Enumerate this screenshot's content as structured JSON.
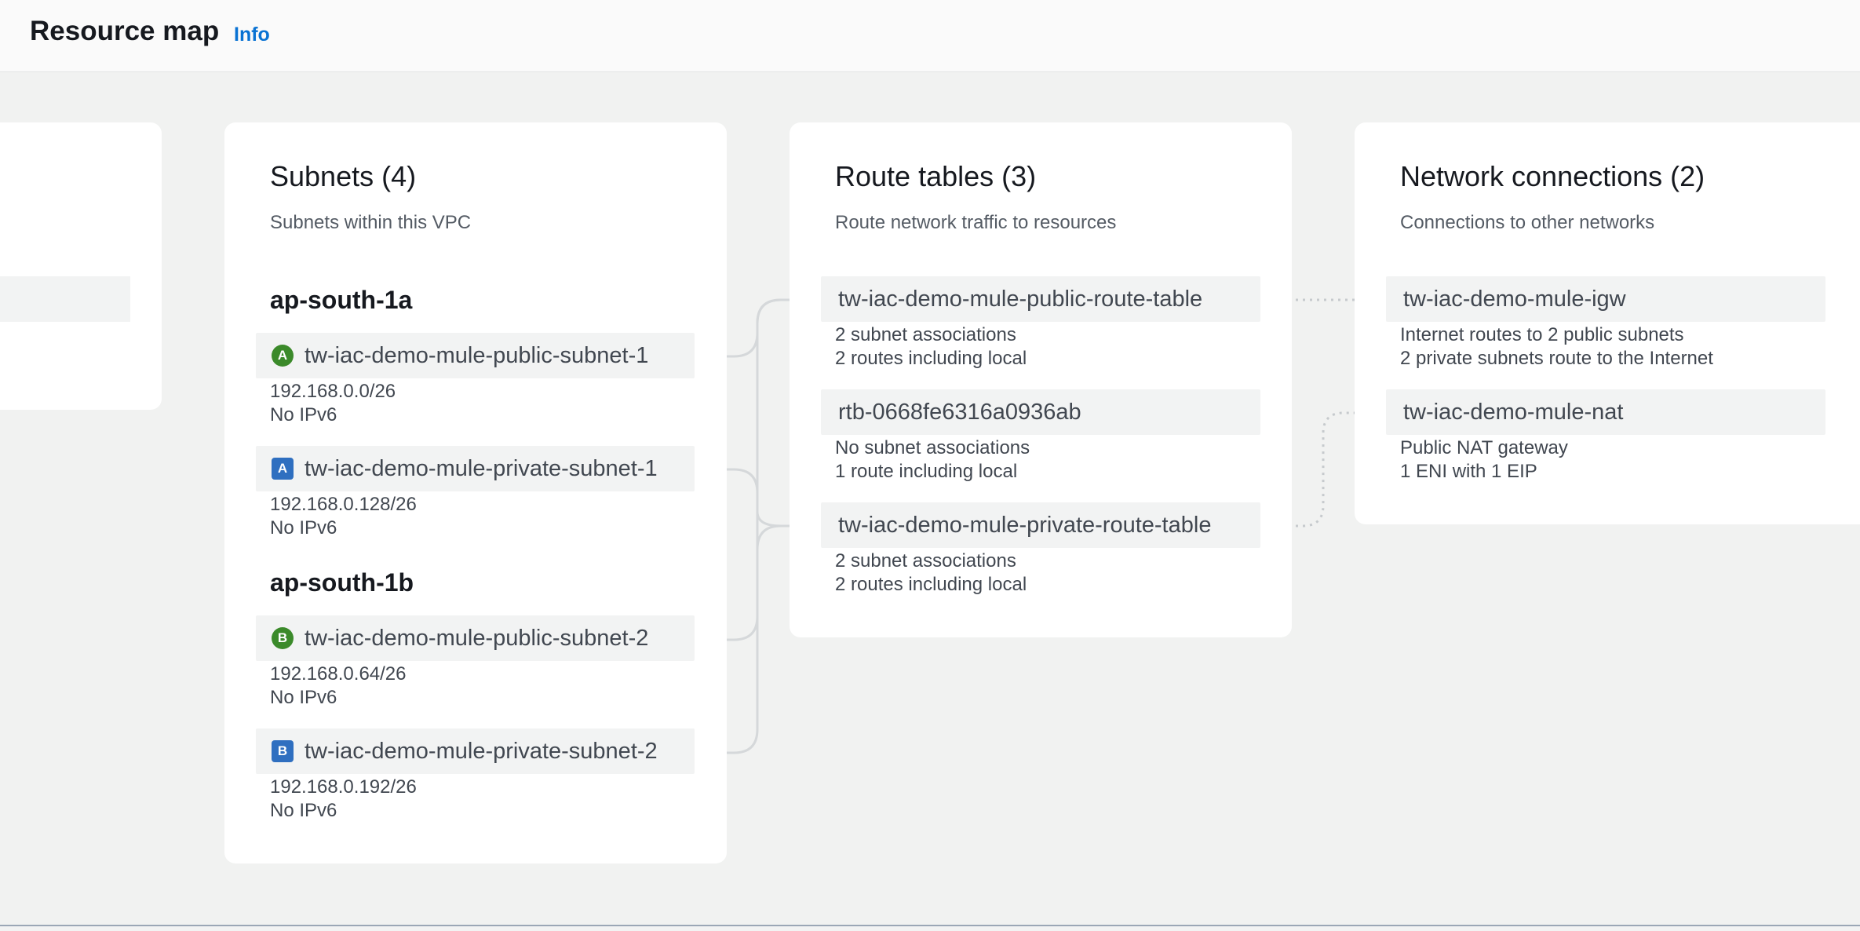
{
  "header": {
    "title": "Resource map",
    "info": "Info"
  },
  "subnets": {
    "title": "Subnets (4)",
    "description": "Subnets within this VPC",
    "zones": [
      {
        "name": "ap-south-1a"
      },
      {
        "name": "ap-south-1b"
      }
    ],
    "items": [
      {
        "badge": "A",
        "badge_type": "public",
        "name": "tw-iac-demo-mule-public-subnet-1",
        "cidr": "192.168.0.0/26",
        "ipv6": "No IPv6"
      },
      {
        "badge": "A",
        "badge_type": "private",
        "name": "tw-iac-demo-mule-private-subnet-1",
        "cidr": "192.168.0.128/26",
        "ipv6": "No IPv6"
      },
      {
        "badge": "B",
        "badge_type": "public",
        "name": "tw-iac-demo-mule-public-subnet-2",
        "cidr": "192.168.0.64/26",
        "ipv6": "No IPv6"
      },
      {
        "badge": "B",
        "badge_type": "private",
        "name": "tw-iac-demo-mule-private-subnet-2",
        "cidr": "192.168.0.192/26",
        "ipv6": "No IPv6"
      }
    ]
  },
  "route_tables": {
    "title": "Route tables (3)",
    "description": "Route network traffic to resources",
    "items": [
      {
        "name": "tw-iac-demo-mule-public-route-table",
        "line1": "2 subnet associations",
        "line2": "2 routes including local"
      },
      {
        "name": "rtb-0668fe6316a0936ab",
        "line1": "No subnet associations",
        "line2": "1 route including local"
      },
      {
        "name": "tw-iac-demo-mule-private-route-table",
        "line1": "2 subnet associations",
        "line2": "2 routes including local"
      }
    ]
  },
  "network_connections": {
    "title": "Network connections (2)",
    "description": "Connections to other networks",
    "items": [
      {
        "name": "tw-iac-demo-mule-igw",
        "line1": "Internet routes to 2 public subnets",
        "line2": "2 private subnets route to the Internet"
      },
      {
        "name": "tw-iac-demo-mule-nat",
        "line1": "Public NAT gateway",
        "line2": "1 ENI with 1 EIP"
      }
    ]
  },
  "colors": {
    "public_badge": "#3b8a2a",
    "private_badge": "#2f6fc0",
    "link": "#0972d3",
    "connector": "#d1d5db"
  }
}
